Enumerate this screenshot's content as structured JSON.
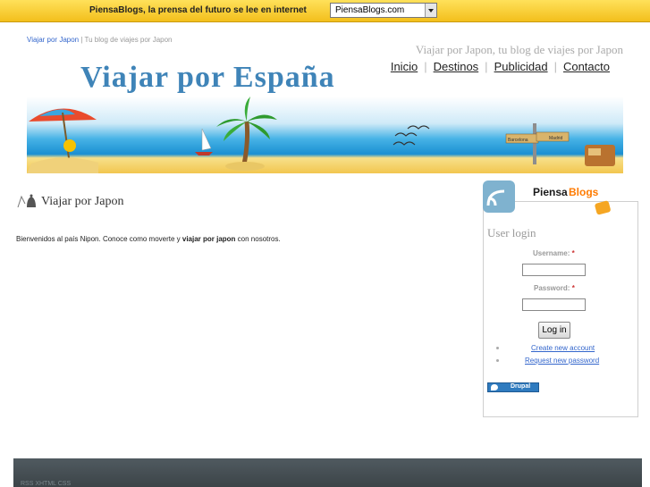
{
  "topbar": {
    "promo_text": "PiensaBlogs, la prensa del futuro se lee en internet",
    "select_value": "PiensaBlogs.com"
  },
  "header": {
    "breadcrumb_link": "Viajar por Japon",
    "breadcrumb_rest": " | Tu blog de viajes por Japon",
    "slogan": "Viajar por Japon, tu blog de viajes por Japon",
    "logo_text": "Viajar por España",
    "nav": [
      "Inicio",
      "Destinos",
      "Publicidad",
      "Contacto"
    ],
    "banner_signs": [
      "Barcelona",
      "Madrid"
    ]
  },
  "content": {
    "title": "Viajar por Japon",
    "text_before": "Bienvenidos al país Nipon. Conoce como moverte y ",
    "text_bold": "viajar por japon",
    "text_after": " con nosotros."
  },
  "sidebar": {
    "brand_a": "Piensa",
    "brand_b": "Blogs",
    "login_title": "User login",
    "username_label": "Username: ",
    "password_label": "Password: ",
    "required_mark": "*",
    "login_button": "Log in",
    "create_account": "Create new account",
    "request_password": "Request new password",
    "drupal_badge": "Drupal"
  },
  "footer": {
    "links": "RSS  XHTML  CSS"
  },
  "colors": {
    "topbar": "#f3bf1c",
    "logo": "#3f84b8",
    "link": "#3366cc",
    "footer": "#3c4448"
  }
}
